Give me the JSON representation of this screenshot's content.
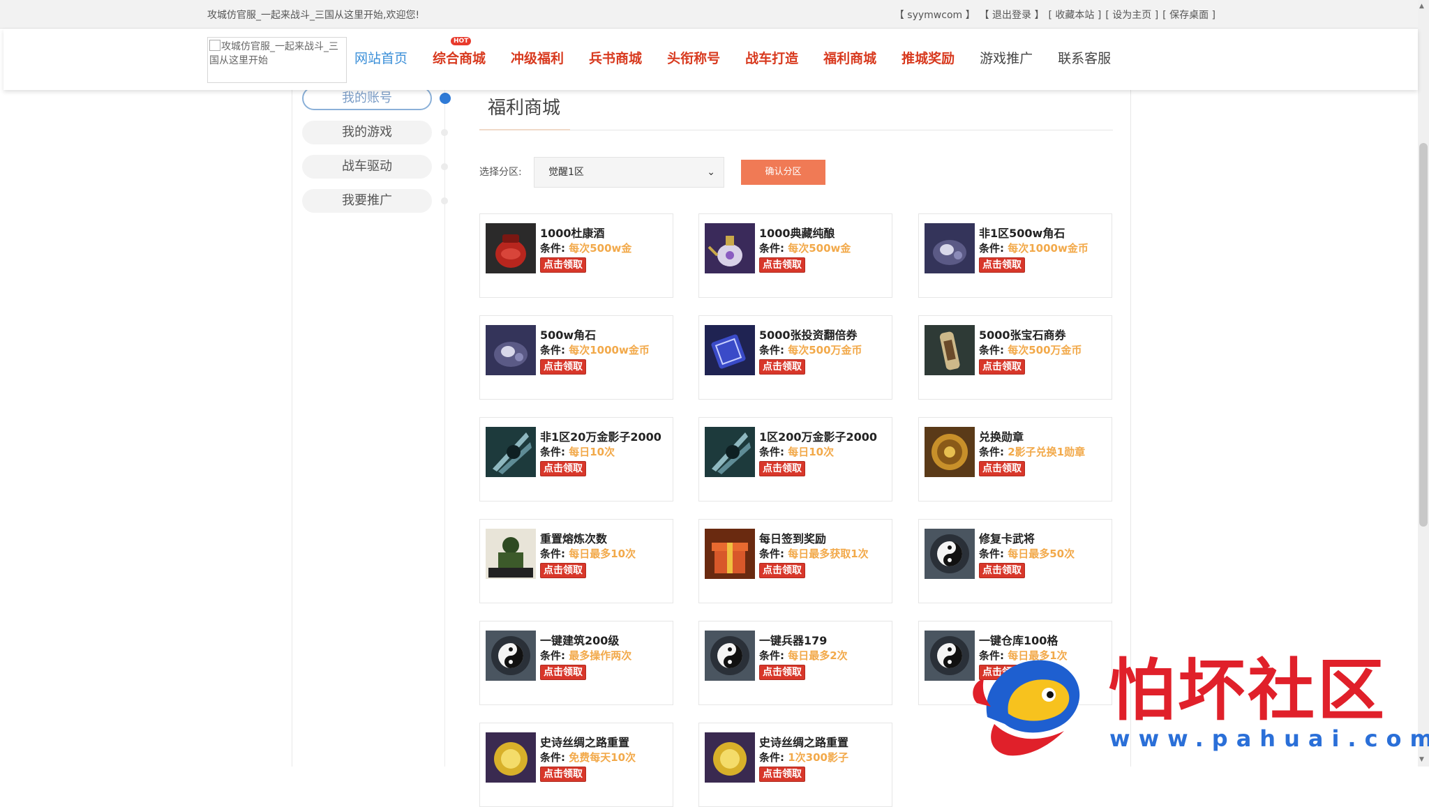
{
  "topbar": {
    "welcome": "攻城仿官服_一起来战斗_三国从这里开始,欢迎您!",
    "links": [
      "【  syymwcom  】",
      "【  退出登录  】",
      "[  收藏本站  ]",
      "[  设为主页  ]",
      "[  保存桌面  ]"
    ]
  },
  "header": {
    "logo_alt": "攻城仿官服_一起来战斗_三国从这里开始",
    "nav": [
      {
        "label": "网站首页"
      },
      {
        "label": "综合商城",
        "badge": "HOT"
      },
      {
        "label": "冲级福利"
      },
      {
        "label": "兵书商城"
      },
      {
        "label": "头衔称号"
      },
      {
        "label": "战车打造"
      },
      {
        "label": "福利商城"
      },
      {
        "label": "推城奖励"
      },
      {
        "label": "游戏推广"
      },
      {
        "label": "联系客服"
      }
    ]
  },
  "sidebar": {
    "items": [
      "我的账号",
      "我的游戏",
      "战车驱动",
      "我要推广"
    ],
    "active_index": 0
  },
  "main": {
    "title": "福利商城",
    "zone_label": "选择分区:",
    "zone_selected": "觉醒1区",
    "confirm_label": "确认分区",
    "condition_prefix": "条件:",
    "claim_label": "点击领取",
    "cards": [
      {
        "name": "1000杜康酒",
        "condition": "每次500w金",
        "icon": "wine-jar-icon"
      },
      {
        "name": "1000典藏纯酿",
        "condition": "每次500w金",
        "icon": "ornate-teapot-icon"
      },
      {
        "name": "非1区500w角石",
        "condition": "每次1000w金币",
        "icon": "horn-stone-icon"
      },
      {
        "name": "500w角石",
        "condition": "每次1000w金币",
        "icon": "horn-stone-icon"
      },
      {
        "name": "5000张投资翻倍券",
        "condition": "每次500万金币",
        "icon": "investment-ticket-icon"
      },
      {
        "name": "5000张宝石商券",
        "condition": "每次500万金币",
        "icon": "gem-scroll-icon"
      },
      {
        "name": "非1区20万金影子2000",
        "condition": "每日10次",
        "icon": "shadow-blades-icon"
      },
      {
        "name": "1区200万金影子2000",
        "condition": "每日10次",
        "icon": "shadow-blades-icon"
      },
      {
        "name": "兑换勋章",
        "condition": "2影子兑换1勋章",
        "icon": "medal-icon"
      },
      {
        "name": "重置熔炼次数",
        "condition": "每日最多10次",
        "icon": "general-portrait-icon"
      },
      {
        "name": "每日签到奖励",
        "condition": "每日最多获取1次",
        "icon": "gift-box-icon"
      },
      {
        "name": "修复卡武将",
        "condition": "每日最多50次",
        "icon": "yin-yang-icon"
      },
      {
        "name": "一键建筑200级",
        "condition": "最多操作两次",
        "icon": "yin-yang-icon"
      },
      {
        "name": "一键兵器179",
        "condition": "每日最多2次",
        "icon": "yin-yang-icon"
      },
      {
        "name": "一键仓库100格",
        "condition": "每日最多1次",
        "icon": "yin-yang-icon"
      },
      {
        "name": "史诗丝绸之路重置",
        "condition": "免费每天10次",
        "icon": "golden-orb-icon"
      },
      {
        "name": "史诗丝绸之路重置",
        "condition": "1次300影子",
        "icon": "golden-orb-icon"
      }
    ]
  },
  "watermark": {
    "text": "怕坏社区",
    "url": "www.pahuai.com"
  },
  "colors": {
    "nav_red": "#d83a1f",
    "nav_blue": "#3b8fd8",
    "condition_orange": "#f2a94a",
    "claim_red": "#d8372a",
    "confirm_orange": "#f07a55",
    "side_active_dot": "#2f7ad6"
  }
}
